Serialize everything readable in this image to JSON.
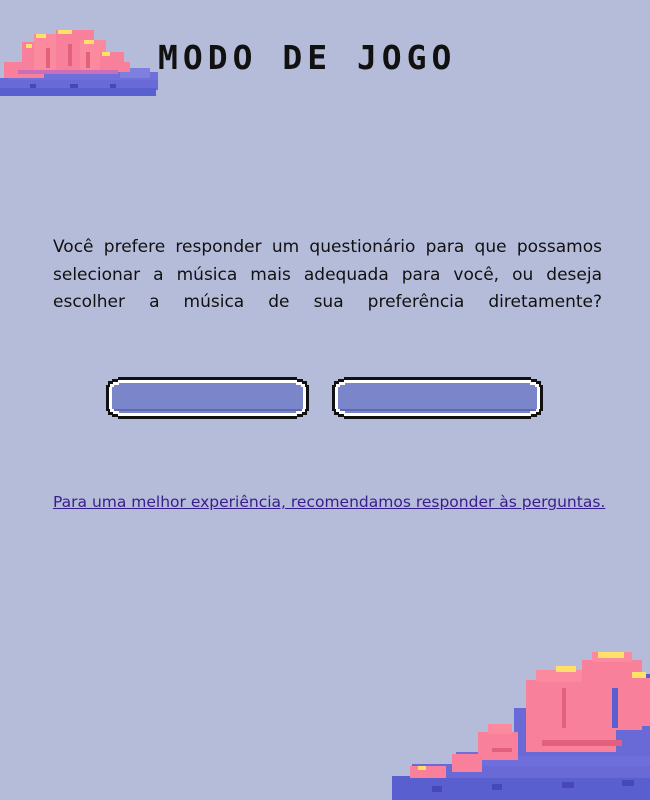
{
  "header": {
    "title": "MODO DE JOGO"
  },
  "main": {
    "question": "Você prefere responder um questionário para que possamos selecionar a música mais adequada para você, ou deseja escolher a música de sua preferência diretamente?",
    "buttons": [
      {
        "label": ""
      },
      {
        "label": ""
      }
    ],
    "recommendation_link": "Para uma melhor experiência, recomendamos responder às perguntas."
  },
  "colors": {
    "background": "#b5bcda",
    "button_fill": "#7a86c9",
    "cloud_pink": "#f8809a",
    "cloud_purple": "#5a5fd0",
    "cloud_yellow": "#ffe06a",
    "link": "#3a1d8c"
  },
  "icons": {
    "decoration_top": "pixel-cloud-icon",
    "decoration_bottom": "pixel-cloud-icon"
  }
}
